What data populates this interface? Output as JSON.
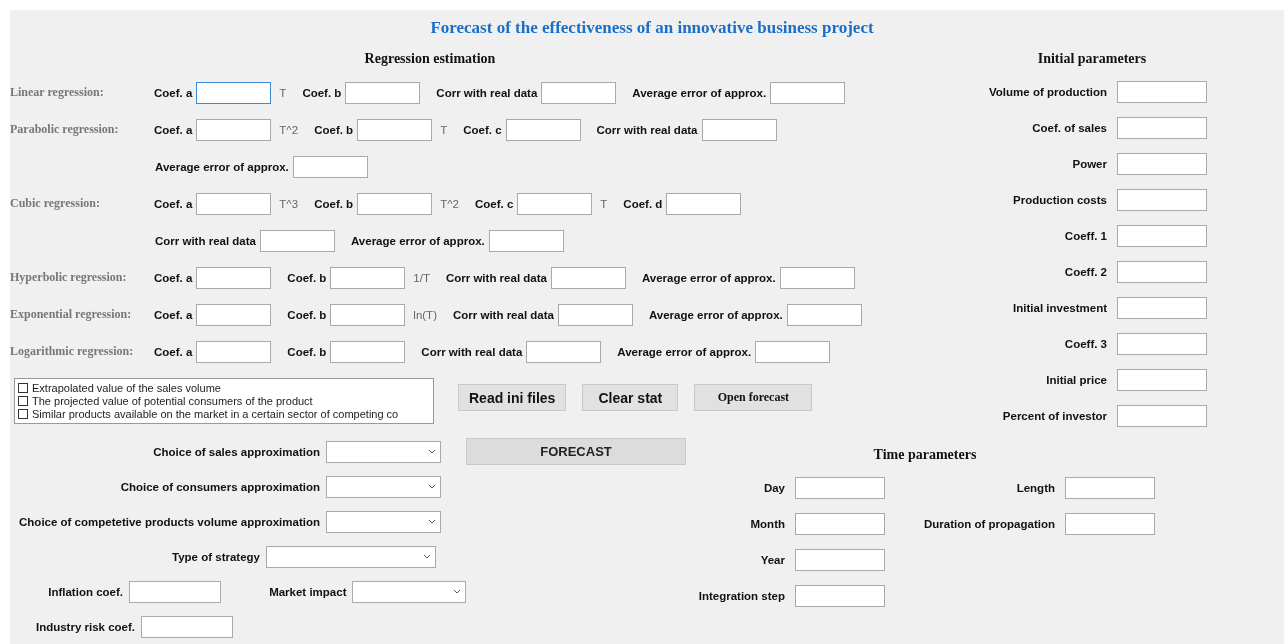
{
  "title": "Forecast of the effectiveness of an innovative business project",
  "regression": {
    "heading": "Regression estimation",
    "rows": [
      {
        "name": "Linear regression:",
        "lines": [
          [
            {
              "label": "Coef. a",
              "unit": "T",
              "focused": true
            },
            {
              "label": "Coef. b"
            },
            {
              "label": "Corr with real data"
            },
            {
              "label": "Average error of approx."
            }
          ]
        ]
      },
      {
        "name": "Parabolic regression:",
        "lines": [
          [
            {
              "label": "Coef. a",
              "unit": "T^2"
            },
            {
              "label": "Coef. b",
              "unit": "T"
            },
            {
              "label": "Coef. c"
            },
            {
              "label": "Corr with real data"
            }
          ],
          [
            {
              "label": "Average error of approx."
            }
          ]
        ]
      },
      {
        "name": "Cubic regression:",
        "lines": [
          [
            {
              "label": "Coef. a",
              "unit": "T^3"
            },
            {
              "label": "Coef. b",
              "unit": "T^2"
            },
            {
              "label": "Coef. c",
              "unit": "T"
            },
            {
              "label": "Coef. d"
            }
          ],
          [
            {
              "label": "Corr with real data"
            },
            {
              "label": "Average error of approx."
            }
          ]
        ]
      },
      {
        "name": "Hyperbolic regression:",
        "lines": [
          [
            {
              "label": "Coef. a"
            },
            {
              "label": "Coef. b",
              "unit": "1/T"
            },
            {
              "label": "Corr with real data"
            },
            {
              "label": "Average error of approx."
            }
          ]
        ]
      },
      {
        "name": "Exponential regression:",
        "lines": [
          [
            {
              "label": "Coef. a"
            },
            {
              "label": "Coef. b",
              "unit": "ln(T)"
            },
            {
              "label": "Corr with real data"
            },
            {
              "label": "Average error of approx."
            }
          ]
        ]
      },
      {
        "name": "Logarithmic regression:",
        "lines": [
          [
            {
              "label": "Coef. a"
            },
            {
              "label": "Coef. b"
            },
            {
              "label": "Corr with real data"
            },
            {
              "label": "Average error of approx."
            }
          ]
        ]
      }
    ]
  },
  "checklist": [
    {
      "label": "Extrapolated value of the sales volume",
      "checked": false
    },
    {
      "label": "The projected value of potential consumers of the product",
      "checked": false
    },
    {
      "label": "Similar products available on the market in a certain sector of competing co",
      "checked": false
    }
  ],
  "buttons": [
    {
      "label": "Read ini files",
      "kind": "sans"
    },
    {
      "label": "Clear stat",
      "kind": "sans"
    },
    {
      "label": "Open forecast",
      "kind": "serif"
    }
  ],
  "forecast_button": "FORECAST",
  "approximations": [
    {
      "label": "Choice of sales approximation"
    },
    {
      "label": "Choice of consumers approximation"
    },
    {
      "label": "Choice of competetive products volume  approximation"
    }
  ],
  "strategy": {
    "label": "Type of strategy"
  },
  "inflation": {
    "label": "Inflation coef."
  },
  "market_impact": {
    "label": "Market impact"
  },
  "industry_risk": {
    "label": "Industry risk coef."
  },
  "initial_parameters": {
    "heading": "Initial parameters",
    "fields": [
      "Volume of production",
      "Coef. of sales",
      "Power",
      "Production costs",
      "Coeff. 1",
      "Coeff. 2",
      "Initial investment",
      "Coeff. 3",
      "Initial price",
      "Percent of investor"
    ]
  },
  "time_parameters": {
    "heading": "Time parameters",
    "left": [
      "Day",
      "Month",
      "Year",
      "Integration step"
    ],
    "right": [
      "Length",
      "Duration of propagation"
    ]
  }
}
